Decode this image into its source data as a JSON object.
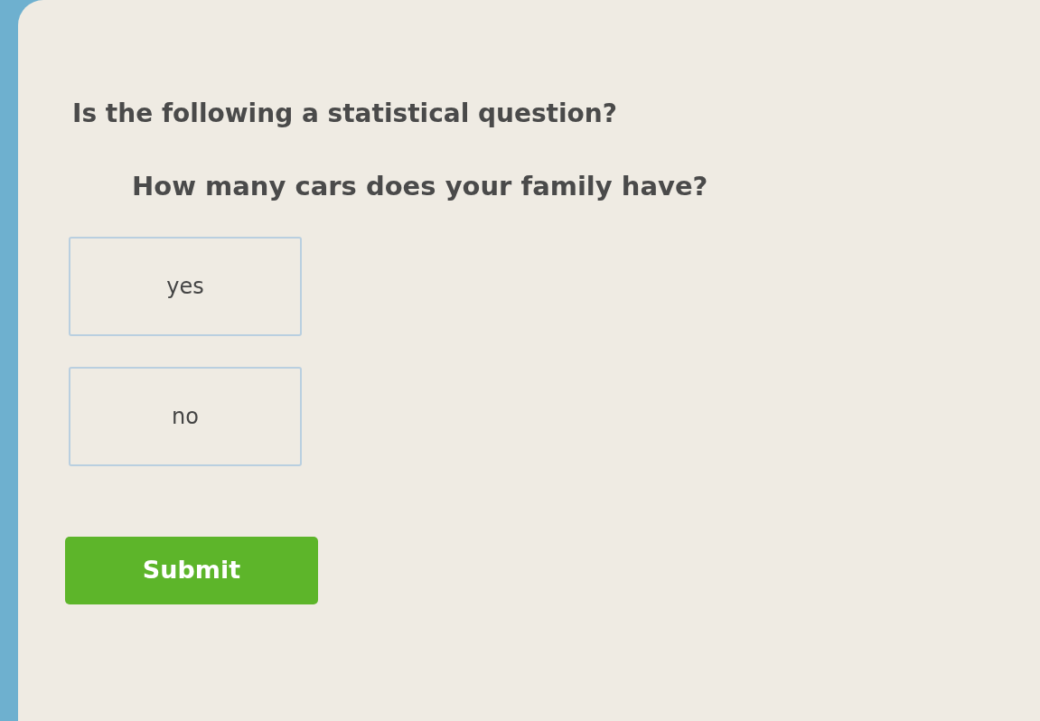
{
  "question": {
    "prompt": "Is the following a statistical question?",
    "text": "How many cars does your family have?"
  },
  "choices": [
    {
      "label": "yes",
      "selected": false
    },
    {
      "label": "no",
      "selected": false
    }
  ],
  "submit_button": {
    "label": "Submit"
  }
}
